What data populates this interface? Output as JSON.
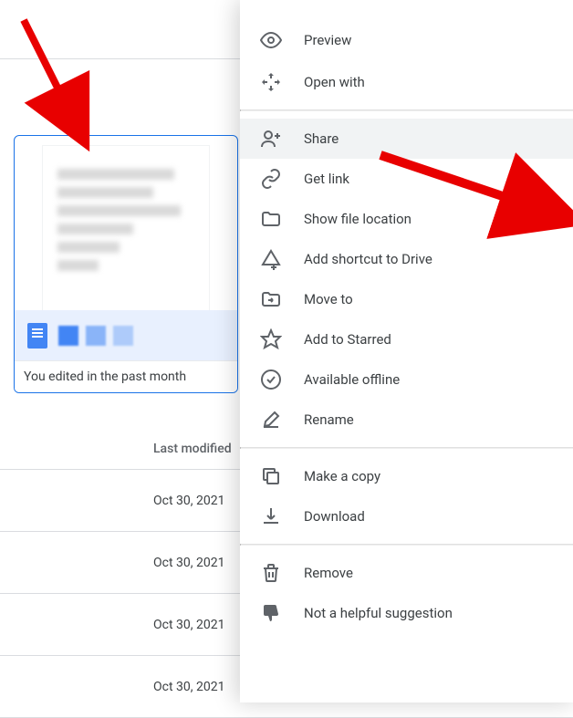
{
  "card": {
    "caption": "You edited in the past month"
  },
  "list": {
    "header": "Last modified",
    "dates": [
      "Oct 30, 2021",
      "Oct 30, 2021",
      "Oct 30, 2021",
      "Oct 30, 2021"
    ]
  },
  "menu": {
    "sections": [
      [
        {
          "icon": "eye-icon",
          "label": "Preview"
        },
        {
          "icon": "open-with-icon",
          "label": "Open with"
        }
      ],
      [
        {
          "icon": "share-icon",
          "label": "Share",
          "highlighted": true
        },
        {
          "icon": "link-icon",
          "label": "Get link"
        },
        {
          "icon": "folder-icon",
          "label": "Show file location"
        },
        {
          "icon": "shortcut-icon",
          "label": "Add shortcut to Drive"
        },
        {
          "icon": "moveto-icon",
          "label": "Move to"
        },
        {
          "icon": "star-icon",
          "label": "Add to Starred"
        },
        {
          "icon": "offline-icon",
          "label": "Available offline"
        },
        {
          "icon": "rename-icon",
          "label": "Rename"
        }
      ],
      [
        {
          "icon": "copy-icon",
          "label": "Make a copy"
        },
        {
          "icon": "download-icon",
          "label": "Download"
        }
      ],
      [
        {
          "icon": "remove-icon",
          "label": "Remove"
        },
        {
          "icon": "thumbsdown-icon",
          "label": "Not a helpful suggestion"
        }
      ]
    ]
  }
}
